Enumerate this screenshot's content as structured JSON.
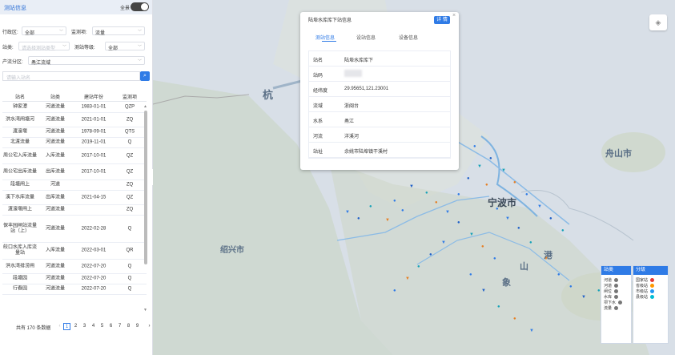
{
  "panel": {
    "title": "测站信息",
    "all_label": "全景",
    "filters": {
      "region_label": "行政区:",
      "region_value": "全部",
      "monitor_label": "监测项:",
      "monitor_value": "流量",
      "type_label": "站类:",
      "type_placeholder": "请选择测站类型",
      "level_label": "测站等级:",
      "level_value": "全部",
      "flow_label": "产流分区:",
      "flow_value": "甬江流域"
    },
    "search_placeholder": "请输入站名",
    "columns": [
      "站名",
      "站类",
      "建站年份",
      "监测项"
    ],
    "rows": [
      [
        "钟家潭",
        "河道流量",
        "1983-01-01",
        "QZP"
      ],
      [
        "洪水湾闸塘河",
        "河道流量",
        "2021-01-01",
        "ZQ"
      ],
      [
        "渡濠堰",
        "河道流量",
        "1978-09-01",
        "QTS"
      ],
      [
        "北渡流量",
        "河道流量",
        "2019-11-01",
        "Q"
      ],
      [
        "周公宅入库流量",
        "入库流量",
        "2017-10-01",
        "QZ"
      ],
      [
        "周公宅出库流量",
        "出库流量",
        "2017-10-01",
        "QZ"
      ],
      [
        "段塘闸上",
        "河道",
        "",
        "ZQ"
      ],
      [
        "溪下水库流量",
        "出库流量",
        "2021-04-15",
        "QZ"
      ],
      [
        "渡濠堰闸上",
        "河道流量",
        "",
        "ZQ"
      ],
      [
        "保丰园闸站流量站（上）",
        "河道流量",
        "2022-02-28",
        "Q"
      ],
      [
        "皎口水库入库流量站",
        "入库流量",
        "2022-03-01",
        "QR"
      ],
      [
        "洪水湾排涝闸",
        "河道流量",
        "2022-07-20",
        "Q"
      ],
      [
        "段塘园",
        "河道流量",
        "2022-07-20",
        "Q"
      ],
      [
        "行春园",
        "河道流量",
        "2022-07-20",
        "Q"
      ]
    ],
    "pager": {
      "total": "共有 170 条数据",
      "pages": [
        "1",
        "2",
        "3",
        "4",
        "5",
        "6",
        "7",
        "8",
        "9"
      ],
      "prev": "‹",
      "next": "›"
    }
  },
  "popup": {
    "title": "陆埠水库库下站信息",
    "detail_button": "详 情",
    "tabs": [
      "测站信息",
      "设站信息",
      "设备信息"
    ],
    "fields": [
      {
        "k": "站名",
        "v": "陆埠水库库下"
      },
      {
        "k": "站码",
        "v": ""
      },
      {
        "k": "经纬度",
        "v": "29.95651,121.23001"
      },
      {
        "k": "流域",
        "v": "浙闽台"
      },
      {
        "k": "水系",
        "v": "甬江"
      },
      {
        "k": "河流",
        "v": "洋溪河"
      },
      {
        "k": "站址",
        "v": "余姚市陆埠镇干溪村"
      }
    ]
  },
  "map": {
    "labels": [
      {
        "text": "杭",
        "name": "city-hangzhou"
      },
      {
        "text": "绍兴市",
        "name": "city-shaoxing"
      },
      {
        "text": "宁波市",
        "name": "city-ningbo"
      },
      {
        "text": "舟山市",
        "name": "city-zhoushan"
      },
      {
        "text": "山",
        "name": "label-shan"
      },
      {
        "text": "港",
        "name": "label-gang"
      },
      {
        "text": "象",
        "name": "label-xiang"
      }
    ]
  },
  "legend": {
    "station_title": "站类",
    "station_items": [
      "河道",
      "河道",
      "闸位",
      "水库",
      "坝下水",
      "流量"
    ],
    "level_title": "分级",
    "level_items": [
      "国家站",
      "省级站",
      "市级站",
      "县级站"
    ],
    "level_colors": [
      "#e53935",
      "#ff9800",
      "#2196f3",
      "#00bcd4"
    ]
  },
  "colors": {
    "accent": "#2f7be6"
  }
}
